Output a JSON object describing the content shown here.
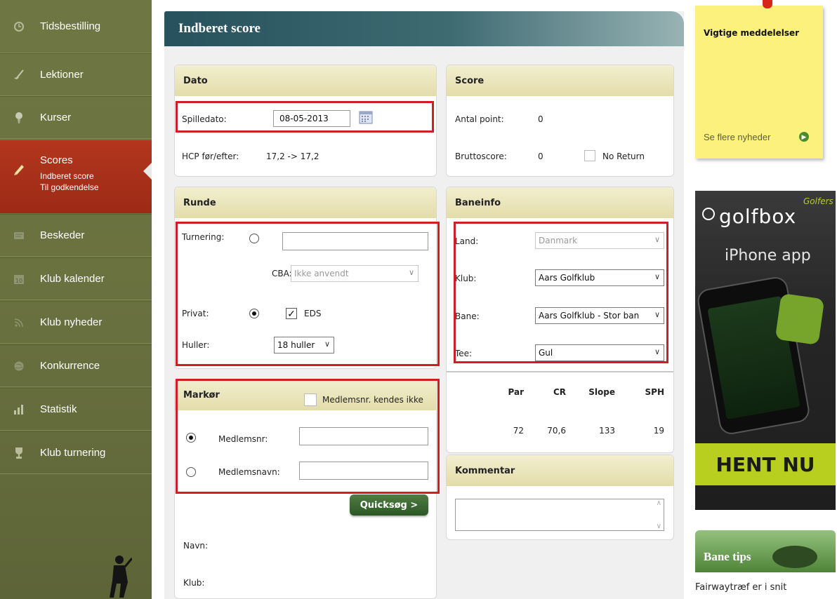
{
  "sidebar": {
    "items": [
      {
        "label": "Tidsbestilling",
        "icon": "clock-icon"
      },
      {
        "label": "Lektioner",
        "icon": "golf-club-icon"
      },
      {
        "label": "Kurser",
        "icon": "golf-ball-tee-icon"
      },
      {
        "label": "Scores",
        "icon": "pencil-icon",
        "active": true,
        "sub": [
          "Indberet score",
          "Til godkendelse"
        ]
      },
      {
        "label": "Beskeder",
        "icon": "message-icon"
      },
      {
        "label": "Klub kalender",
        "icon": "calendar-icon"
      },
      {
        "label": "Klub nyheder",
        "icon": "rss-icon"
      },
      {
        "label": "Konkurrence",
        "icon": "globe-icon"
      },
      {
        "label": "Statistik",
        "icon": "bar-chart-icon"
      },
      {
        "label": "Klub turnering",
        "icon": "trophy-icon"
      }
    ]
  },
  "main": {
    "title": "Indberet score",
    "dato": {
      "header": "Dato",
      "spilledato_label": "Spilledato:",
      "spilledato_value": "08-05-2013",
      "hcp_label": "HCP før/efter:",
      "hcp_value": "17,2 -> 17,2"
    },
    "score": {
      "header": "Score",
      "antal_label": "Antal point:",
      "antal_value": "0",
      "brutto_label": "Bruttoscore:",
      "brutto_value": "0",
      "noreturn_label": "No Return"
    },
    "runde": {
      "header": "Runde",
      "turnering_label": "Turnering:",
      "turnering_value": "",
      "cba_label": "CBA:",
      "cba_value": "Ikke anvendt",
      "privat_label": "Privat:",
      "eds_label": "EDS",
      "huller_label": "Huller:",
      "huller_value": "18 huller"
    },
    "baneinfo": {
      "header": "Baneinfo",
      "land_label": "Land:",
      "land_value": "Danmark",
      "klub_label": "Klub:",
      "klub_value": "Aars Golfklub",
      "bane_label": "Bane:",
      "bane_value": "Aars Golfklub - Stor ban",
      "tee_label": "Tee:",
      "tee_value": "Gul",
      "stats_headers": [
        "Par",
        "CR",
        "Slope",
        "SPH"
      ],
      "stats_values": [
        "72",
        "70,6",
        "133",
        "19"
      ]
    },
    "markor": {
      "header": "Markør",
      "unknown_label": "Medlemsnr. kendes ikke",
      "medlemsnr_label": "Medlemsnr:",
      "medlemsnavn_label": "Medlemsnavn:",
      "quicksearch_label": "Quicksøg >",
      "navn_label": "Navn:",
      "klub_label": "Klub:"
    },
    "kommentar": {
      "header": "Kommentar"
    }
  },
  "right": {
    "sticky_title": "Vigtige meddelelser",
    "sticky_link": "Se flere nyheder",
    "ad_brand": "golfbox",
    "ad_brand_tag": "Golfers",
    "ad_subtitle": "iPhone app",
    "ad_cta": "HENT NU",
    "banetips_title": "Bane tips",
    "banetips_text": "Fairwaytræf er i snit"
  }
}
